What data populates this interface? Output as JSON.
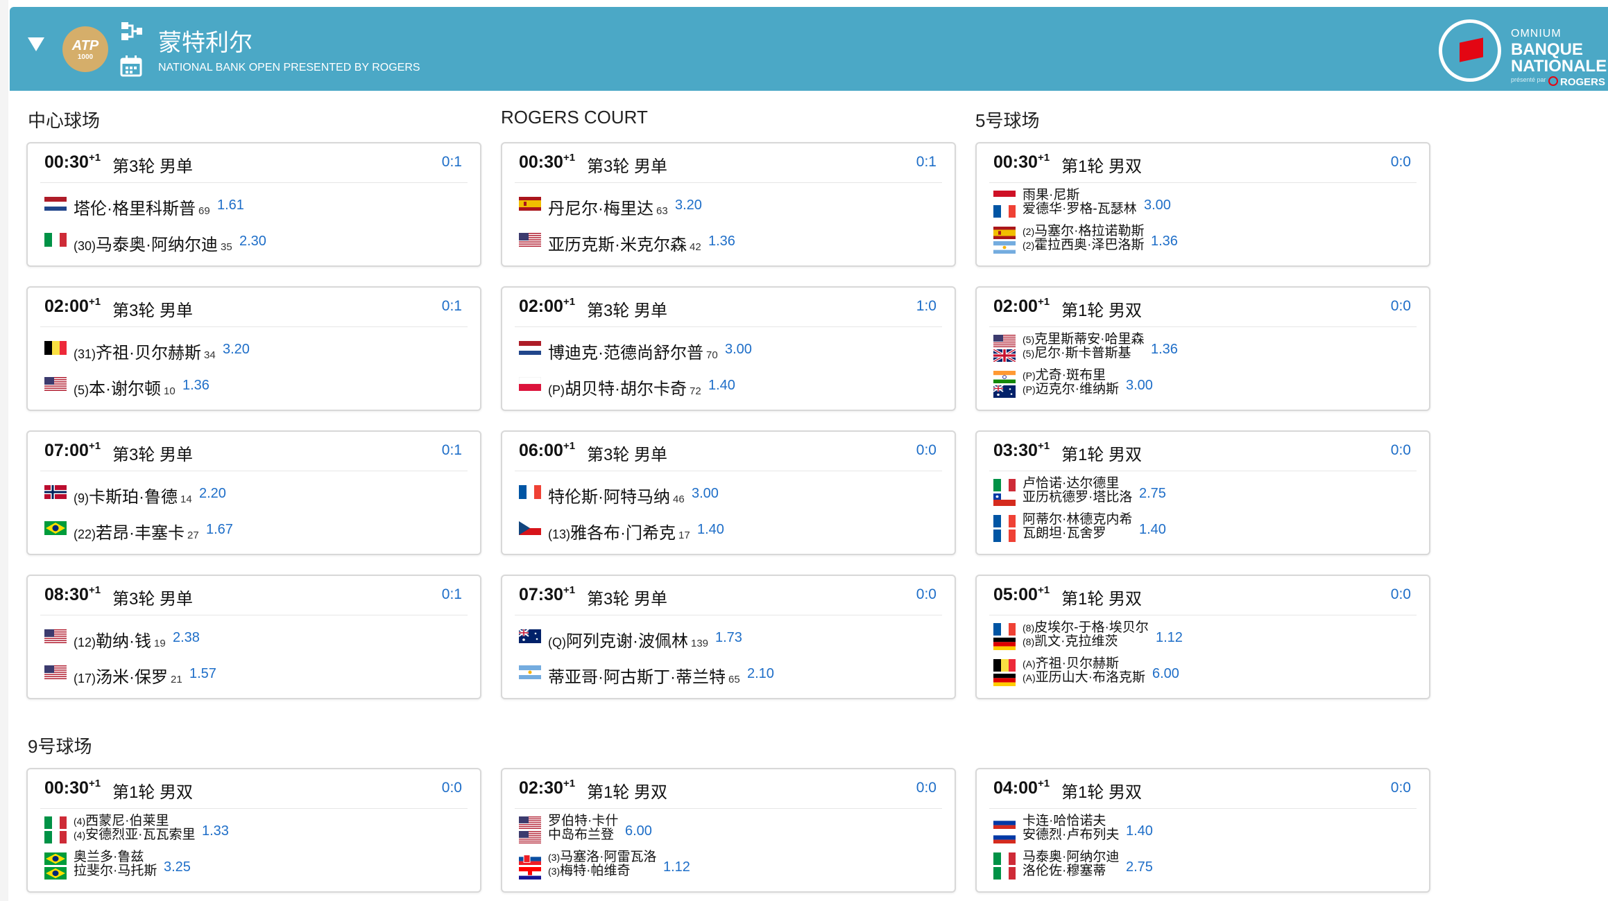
{
  "header": {
    "tournament_title": "蒙特利尔",
    "tournament_subtitle": "NATIONAL BANK OPEN PRESENTED BY ROGERS",
    "atp_logo_text": "ATP",
    "atp_logo_sub": "MASTERS 1000",
    "sponsor": {
      "line1": "OMNIUM",
      "line2": "BANQUE",
      "line3": "NATIONALE",
      "presented": "présenté par",
      "brand": "ROGERS",
      "flag_color": "#e30613"
    },
    "colors": {
      "header_bg": "#4ba8c6",
      "odds": "#1e6ec8"
    }
  },
  "courts": [
    {
      "name": "中心球场",
      "matches": [
        {
          "time": "00:30",
          "plus": "+1",
          "round": "第3轮 男单",
          "score": "0:1",
          "p1": {
            "flag": "nl",
            "seed": "",
            "name": "塔伦·格里科斯普",
            "rank": "69",
            "odds": "1.61"
          },
          "p2": {
            "flag": "it",
            "seed": "(30)",
            "name": "马泰奥·阿纳尔迪",
            "rank": "35",
            "odds": "2.30"
          }
        },
        {
          "time": "02:00",
          "plus": "+1",
          "round": "第3轮 男单",
          "score": "0:1",
          "p1": {
            "flag": "be",
            "seed": "(31)",
            "name": "齐祖·贝尔赫斯",
            "rank": "34",
            "odds": "3.20"
          },
          "p2": {
            "flag": "us",
            "seed": "(5)",
            "name": "本·谢尔顿",
            "rank": "10",
            "odds": "1.36"
          }
        },
        {
          "time": "07:00",
          "plus": "+1",
          "round": "第3轮 男单",
          "score": "0:1",
          "p1": {
            "flag": "no",
            "seed": "(9)",
            "name": "卡斯珀·鲁德",
            "rank": "14",
            "odds": "2.20"
          },
          "p2": {
            "flag": "br",
            "seed": "(22)",
            "name": "若昂·丰塞卡",
            "rank": "27",
            "odds": "1.67"
          }
        },
        {
          "time": "08:30",
          "plus": "+1",
          "round": "第3轮 男单",
          "score": "0:1",
          "p1": {
            "flag": "us",
            "seed": "(12)",
            "name": "勒纳·钱",
            "rank": "19",
            "odds": "2.38"
          },
          "p2": {
            "flag": "us",
            "seed": "(17)",
            "name": "汤米·保罗",
            "rank": "21",
            "odds": "1.57"
          }
        }
      ]
    },
    {
      "name": "ROGERS COURT",
      "matches": [
        {
          "time": "00:30",
          "plus": "+1",
          "round": "第3轮 男单",
          "score": "0:1",
          "p1": {
            "flag": "es",
            "seed": "",
            "name": "丹尼尔·梅里达",
            "rank": "63",
            "odds": "3.20"
          },
          "p2": {
            "flag": "us",
            "seed": "",
            "name": "亚历克斯·米克尔森",
            "rank": "42",
            "odds": "1.36"
          }
        },
        {
          "time": "02:00",
          "plus": "+1",
          "round": "第3轮 男单",
          "score": "1:0",
          "p1": {
            "flag": "nl",
            "seed": "",
            "name": "博迪克·范德尚舒尔普",
            "rank": "70",
            "odds": "3.00"
          },
          "p2": {
            "flag": "pl",
            "seed": "(P)",
            "name": "胡贝特·胡尔卡奇",
            "rank": "72",
            "odds": "1.40"
          }
        },
        {
          "time": "06:00",
          "plus": "+1",
          "round": "第3轮 男单",
          "score": "0:0",
          "p1": {
            "flag": "fr",
            "seed": "",
            "name": "特伦斯·阿特马纳",
            "rank": "46",
            "odds": "3.00"
          },
          "p2": {
            "flag": "cz",
            "seed": "(13)",
            "name": "雅各布·门希克",
            "rank": "17",
            "odds": "1.40"
          }
        },
        {
          "time": "07:30",
          "plus": "+1",
          "round": "第3轮 男单",
          "score": "0:0",
          "p1": {
            "flag": "au",
            "seed": "(Q)",
            "name": "阿列克谢·波佩林",
            "rank": "139",
            "odds": "1.73"
          },
          "p2": {
            "flag": "ar",
            "seed": "",
            "name": "蒂亚哥·阿古斯丁·蒂兰特",
            "rank": "65",
            "odds": "2.10"
          }
        }
      ]
    },
    {
      "name": "5号球场",
      "matches": [
        {
          "time": "00:30",
          "plus": "+1",
          "round": "第1轮 男双",
          "score": "0:0",
          "t1": {
            "flags": [
              "id",
              "fr"
            ],
            "names": [
              "雨果·尼斯",
              "爱德华·罗格-瓦瑟林"
            ],
            "seeds": [
              "",
              ""
            ],
            "odds": "3.00"
          },
          "t2": {
            "flags": [
              "es",
              "ar"
            ],
            "names": [
              "马塞尔·格拉诺勒斯",
              "霍拉西奥·泽巴洛斯"
            ],
            "seeds": [
              "(2)",
              "(2)"
            ],
            "odds": "1.36"
          }
        },
        {
          "time": "02:00",
          "plus": "+1",
          "round": "第1轮 男双",
          "score": "0:0",
          "t1": {
            "flags": [
              "us",
              "gb"
            ],
            "names": [
              "克里斯蒂安·哈里森",
              "尼尔·斯卡普斯基"
            ],
            "seeds": [
              "(5)",
              "(5)"
            ],
            "odds": "1.36"
          },
          "t2": {
            "flags": [
              "in",
              "au"
            ],
            "names": [
              "尤奇·斑布里",
              "迈克尔·维纳斯"
            ],
            "seeds": [
              "(P)",
              "(P)"
            ],
            "odds": "3.00"
          }
        },
        {
          "time": "03:30",
          "plus": "+1",
          "round": "第1轮 男双",
          "score": "0:0",
          "t1": {
            "flags": [
              "it",
              "cl"
            ],
            "names": [
              "卢恰诺·达尔德里",
              "亚历杭德罗·塔比洛"
            ],
            "seeds": [
              "",
              ""
            ],
            "odds": "2.75"
          },
          "t2": {
            "flags": [
              "fr",
              "fr"
            ],
            "names": [
              "阿蒂尔·林德克内希",
              "瓦朗坦·瓦舍罗"
            ],
            "seeds": [
              "",
              ""
            ],
            "odds": "1.40"
          }
        },
        {
          "time": "05:00",
          "plus": "+1",
          "round": "第1轮 男双",
          "score": "0:0",
          "t1": {
            "flags": [
              "fr",
              "de"
            ],
            "names": [
              "皮埃尔-于格·埃贝尔",
              "凯文·克拉维茨"
            ],
            "seeds": [
              "(8)",
              "(8)"
            ],
            "odds": "1.12"
          },
          "t2": {
            "flags": [
              "be",
              "de"
            ],
            "names": [
              "齐祖·贝尔赫斯",
              "亚历山大·布洛克斯"
            ],
            "seeds": [
              "(A)",
              "(A)"
            ],
            "odds": "6.00"
          }
        }
      ]
    },
    {
      "name": "9号球场",
      "matches": [
        {
          "time": "00:30",
          "plus": "+1",
          "round": "第1轮 男双",
          "score": "0:0",
          "t1": {
            "flags": [
              "it",
              "it"
            ],
            "names": [
              "西蒙尼·伯莱里",
              "安德烈亚·瓦瓦索里"
            ],
            "seeds": [
              "(4)",
              "(4)"
            ],
            "odds": "1.33"
          },
          "t2": {
            "flags": [
              "br",
              "br"
            ],
            "names": [
              "奥兰多·鲁兹",
              "拉斐尔·马托斯"
            ],
            "seeds": [
              "",
              ""
            ],
            "odds": "3.25"
          }
        },
        {
          "time": "02:30",
          "plus": "+1",
          "round": "第1轮 男双",
          "score": "0:0",
          "t1": {
            "flags": [
              "us",
              "us"
            ],
            "names": [
              "罗伯特·卡什",
              "中岛布兰登"
            ],
            "seeds": [
              "",
              ""
            ],
            "odds": "6.00"
          },
          "t2": {
            "flags": [
              "sk",
              "hr"
            ],
            "names": [
              "马塞洛·阿雷瓦洛",
              "梅特·帕维奇"
            ],
            "seeds": [
              "(3)",
              "(3)"
            ],
            "odds": "1.12"
          }
        },
        {
          "time": "04:00",
          "plus": "+1",
          "round": "第1轮 男双",
          "score": "0:0",
          "t1": {
            "flags": [
              "ru",
              "ru"
            ],
            "names": [
              "卡连·哈恰诺夫",
              "安德烈·卢布列夫"
            ],
            "seeds": [
              "",
              ""
            ],
            "odds": "1.40"
          },
          "t2": {
            "flags": [
              "it",
              "it"
            ],
            "names": [
              "马泰奥·阿纳尔迪",
              "洛伦佐·穆塞蒂"
            ],
            "seeds": [
              "",
              ""
            ],
            "odds": "2.75"
          }
        }
      ]
    }
  ]
}
